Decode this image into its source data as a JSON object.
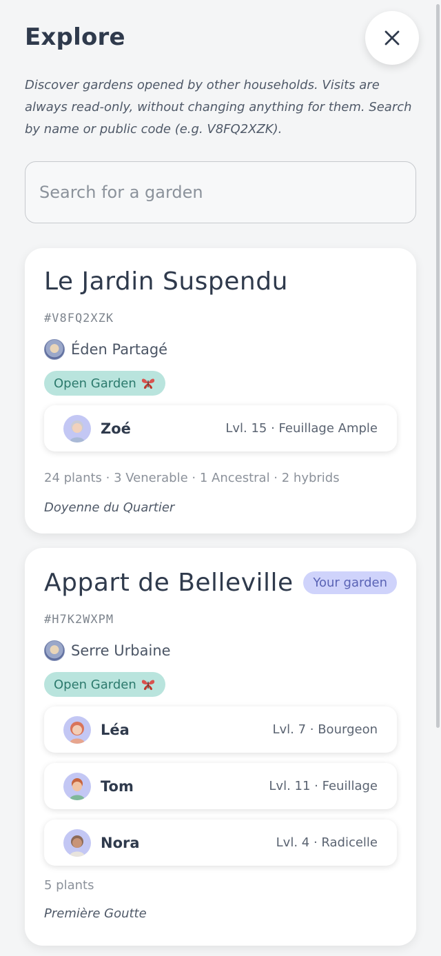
{
  "header": {
    "title": "Explore",
    "close_icon": "close-icon"
  },
  "description": "Discover gardens opened by other households. Visits are always read-only, without changing anything for them. Search by name or public code (e.g. V8FQ2XZK).",
  "search": {
    "placeholder": "Search for a garden",
    "value": ""
  },
  "gardens": [
    {
      "name": "Le Jardin Suspendu",
      "code": "#V8FQ2XZK",
      "pool": "Éden Partagé",
      "open_badge": "Open Garden",
      "open_badge_icon": "butterfly-icon",
      "members": [
        {
          "name": "Zoé",
          "level": "Lvl. 15 · Feuillage Ample",
          "avatar": "avatar-zoe"
        }
      ],
      "stats": "24 plants · 3 Venerable · 1 Ancestral · 2 hybrids",
      "title": "Doyenne du Quartier"
    },
    {
      "name": "Appart de Belleville",
      "badge": "Your garden",
      "code": "#H7K2WXPM",
      "pool": "Serre Urbaine",
      "open_badge": "Open Garden",
      "open_badge_icon": "butterfly-icon",
      "members": [
        {
          "name": "Léa",
          "level": "Lvl. 7 · Bourgeon",
          "avatar": "avatar-lea"
        },
        {
          "name": "Tom",
          "level": "Lvl. 11 · Feuillage",
          "avatar": "avatar-tom"
        },
        {
          "name": "Nora",
          "level": "Lvl. 4 · Radicelle",
          "avatar": "avatar-nora"
        }
      ],
      "stats": "5 plants",
      "title": "Première Goutte"
    }
  ],
  "colors": {
    "background": "#f4f5f6",
    "text": "#2f3a4c",
    "open_badge_bg": "#b9e4dd",
    "open_badge_text": "#2c7a6d",
    "your_badge_bg": "#cfd3fb",
    "your_badge_text": "#5a63b5",
    "avatar_bg": "#c3c7f4"
  }
}
